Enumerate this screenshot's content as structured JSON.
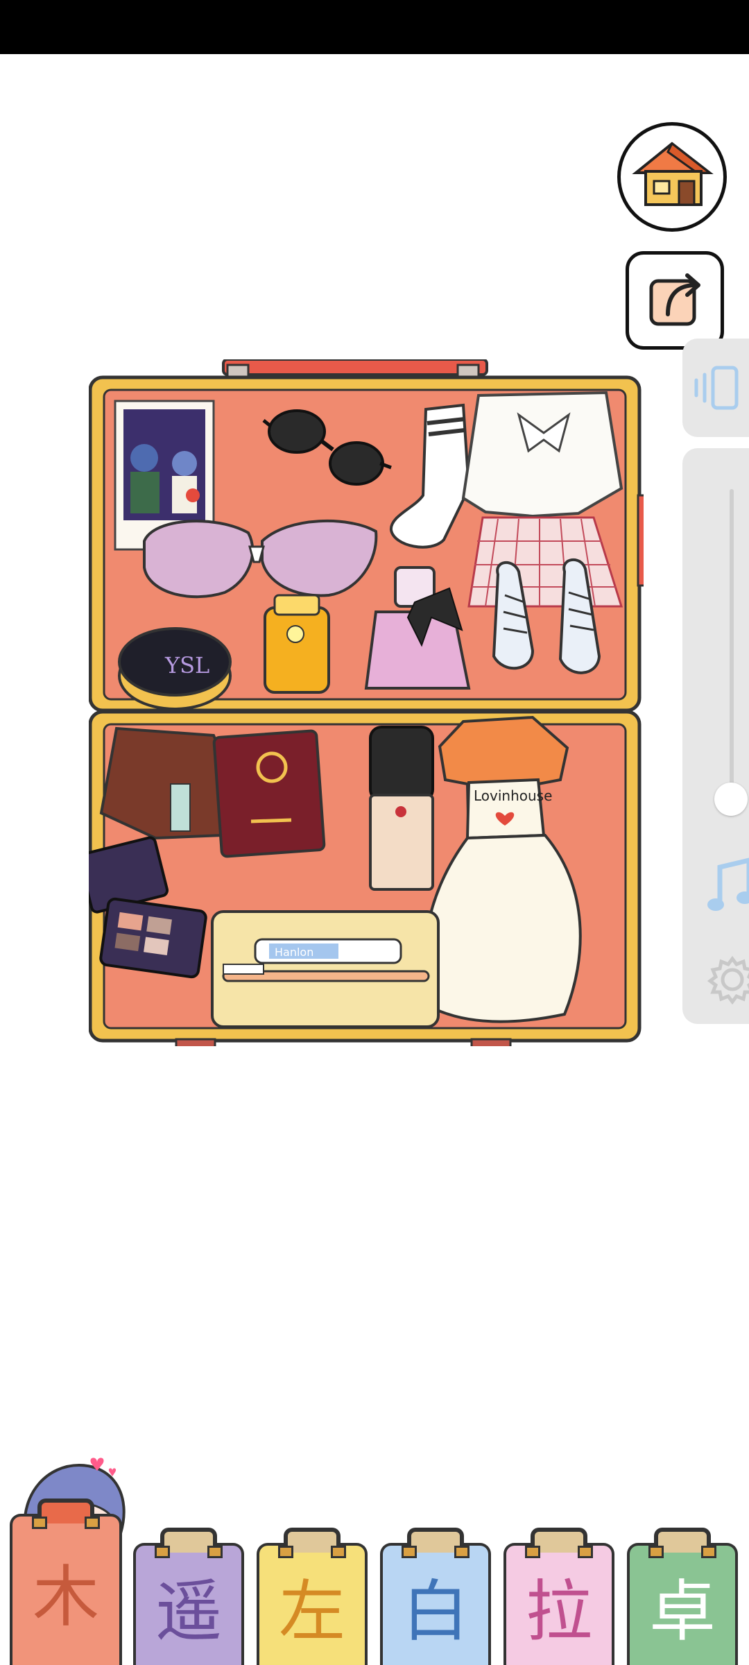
{
  "colors": {
    "statusbar": "#000000",
    "suitcase_frame": "#f2c24f",
    "suitcase_interior": "#f08a6f",
    "side_panel": "#e7e7e7"
  },
  "top_buttons": [
    {
      "name": "home",
      "icon": "house-icon"
    },
    {
      "name": "share",
      "icon": "share-icon"
    }
  ],
  "side_panel": {
    "icons": [
      "vibration-icon",
      "music-note-icon",
      "settings-icon"
    ],
    "volume_level": 0.0
  },
  "suitcase_items": {
    "photo": "photo-polaroid",
    "sunglasses": "sunglasses",
    "sock": "sock",
    "blouse": "white-blouse",
    "bra": "bra",
    "perfume": "perfume-bottle",
    "sneakers": "sneakers",
    "cushion": "ysl-cushion",
    "sunscreen": "sunscreen",
    "wallet": "wallet",
    "passport": "passport",
    "foundation": "foundation-bottle",
    "dress": "dress",
    "dress_text": "Lovinhouse",
    "eyeshadow": "eyeshadow-palette",
    "toiletries": "toothpaste-and-toothbrush",
    "toothpaste_text": "Hanlon"
  },
  "character_tabs": [
    {
      "label": "木",
      "color": "#f1947a",
      "text_color": "#c65a3c",
      "active": true
    },
    {
      "label": "遥",
      "color": "#b9a6d8",
      "text_color": "#6b4f9b",
      "active": false
    },
    {
      "label": "左",
      "color": "#f6e07a",
      "text_color": "#d58a24",
      "active": false
    },
    {
      "label": "白",
      "color": "#b9d6f3",
      "text_color": "#3f74b8",
      "active": false
    },
    {
      "label": "拉",
      "color": "#f5cbe3",
      "text_color": "#c0508f",
      "active": false
    },
    {
      "label": "卓",
      "color": "#8ac493",
      "text_color": "#ffffff",
      "active": false
    }
  ]
}
